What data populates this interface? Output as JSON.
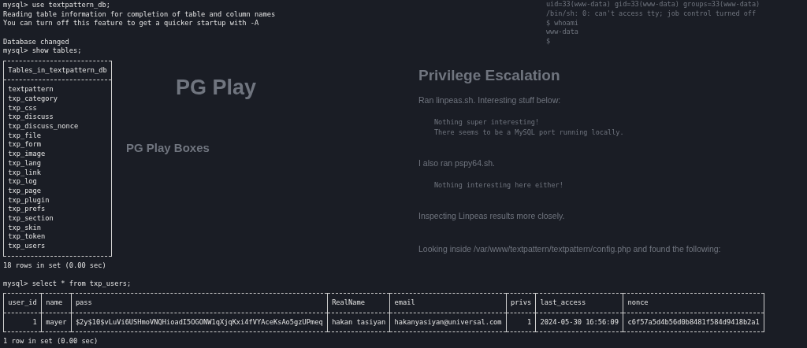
{
  "background_page": {
    "site": {
      "title": "PG Play",
      "section_heading": "PG Play Boxes"
    },
    "shell_output": [
      "uid=33(www-data) gid=33(www-data) groups=33(www-data)",
      "/bin/sh: 0: can't access tty; job control turned off",
      "$ whoami",
      "www-data",
      "$"
    ],
    "article": [
      {
        "kind": "heading",
        "text": "Privilege Escalation"
      },
      {
        "kind": "paragraph",
        "text": "Ran linpeas.sh. Interesting stuff below:"
      },
      {
        "kind": "code",
        "lines": [
          "Nothing super interesting!",
          "There seems to be a MySQL port running locally."
        ]
      },
      {
        "kind": "paragraph",
        "text": "I also ran pspy64.sh."
      },
      {
        "kind": "code",
        "lines": [
          "Nothing interesting here either!"
        ]
      },
      {
        "kind": "paragraph",
        "text": "Inspecting Linpeas results more closely."
      },
      {
        "kind": "gap"
      },
      {
        "kind": "paragraph",
        "text": "Looking inside /var/www/textpattern/textpattern/config.php and found the following:"
      }
    ]
  },
  "terminal": [
    {
      "kind": "command",
      "prompt": "mysql>",
      "text": "use textpattern_db;"
    },
    {
      "kind": "output",
      "text": "Reading table information for completion of table and column names"
    },
    {
      "kind": "output",
      "text": "You can turn off this feature to get a quicker startup with -A"
    },
    {
      "kind": "blank"
    },
    {
      "kind": "output",
      "text": "Database changed"
    },
    {
      "kind": "command",
      "prompt": "mysql>",
      "text": "show tables;"
    },
    {
      "kind": "table",
      "columns": [
        {
          "name": "Tables_in_textpattern_db"
        }
      ],
      "rows": [
        [
          "textpattern"
        ],
        [
          "txp_category"
        ],
        [
          "txp_css"
        ],
        [
          "txp_discuss"
        ],
        [
          "txp_discuss_nonce"
        ],
        [
          "txp_file"
        ],
        [
          "txp_form"
        ],
        [
          "txp_image"
        ],
        [
          "txp_lang"
        ],
        [
          "txp_link"
        ],
        [
          "txp_log"
        ],
        [
          "txp_page"
        ],
        [
          "txp_plugin"
        ],
        [
          "txp_prefs"
        ],
        [
          "txp_section"
        ],
        [
          "txp_skin"
        ],
        [
          "txp_token"
        ],
        [
          "txp_users"
        ]
      ]
    },
    {
      "kind": "output",
      "text": "18 rows in set (0.00 sec)"
    },
    {
      "kind": "blank"
    },
    {
      "kind": "command",
      "prompt": "mysql>",
      "text": "select * from txp_users;"
    },
    {
      "kind": "table",
      "columns": [
        {
          "name": "user_id"
        },
        {
          "name": "name"
        },
        {
          "name": "pass"
        },
        {
          "name": "RealName"
        },
        {
          "name": "email"
        },
        {
          "name": "privs"
        },
        {
          "name": "last_access"
        },
        {
          "name": "nonce"
        }
      ],
      "rows": [
        [
          "1",
          "mayer",
          "$2y$10$vLuVi6USHmoVNQHioadI5OGONW1qXjqKxi4fVYAceKsAo5gzUPmeq",
          "hakan tasiyan",
          "hakanyasiyan@universal.com",
          "1",
          "2024-05-30 16:56:09",
          "c6f57a5d4b56d0b8481f584d9418b2a1"
        ]
      ]
    },
    {
      "kind": "output",
      "text": "1 row in set (0.00 sec)"
    }
  ]
}
